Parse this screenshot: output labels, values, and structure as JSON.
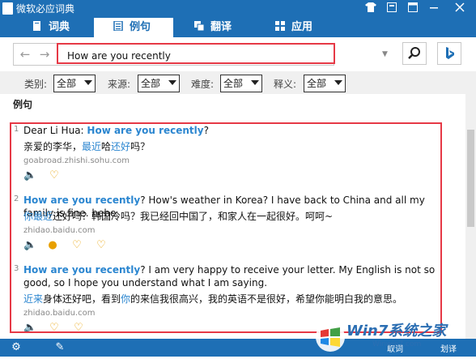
{
  "window": {
    "title": "微软必应词典",
    "controls": [
      "shirt-icon",
      "settings-icon",
      "window-icon",
      "minimize-icon",
      "close-icon"
    ]
  },
  "tabs": [
    {
      "label": "词典",
      "icon": "book-icon",
      "active": false
    },
    {
      "label": "例句",
      "icon": "list-icon",
      "active": true
    },
    {
      "label": "翻译",
      "icon": "translate-icon",
      "active": false
    },
    {
      "label": "应用",
      "icon": "apps-icon",
      "active": false
    }
  ],
  "search": {
    "value": "How are you recently",
    "placeholder": ""
  },
  "filters": [
    {
      "label": "类别:",
      "value": "全部"
    },
    {
      "label": "来源:",
      "value": "全部"
    },
    {
      "label": "难度:",
      "value": "全部"
    },
    {
      "label": "释义:",
      "value": "全部"
    }
  ],
  "section_title": "例句",
  "results": [
    {
      "num": "1",
      "en_prefix": "Dear Li Hua: ",
      "en_hl": "How are you recently",
      "en_suffix": "?",
      "zh_before": "亲爱的李华，",
      "zh_hl1": "最近",
      "zh_mid": "哈",
      "zh_hl2": "还好",
      "zh_after": "吗？",
      "source": "goabroad.zhishi.sohu.com"
    },
    {
      "num": "2",
      "en_prefix": "",
      "en_hl": "How are you recently",
      "en_suffix": "? How's weather in Korea? I have back to China and all my family is fine. hehe",
      "zh_before": "",
      "zh_hl1": "你最近",
      "zh_mid": "还好吗？韩国冷吗？我已经回中国了，和家人在一起很好。呵呵~",
      "zh_hl2": "",
      "zh_after": "",
      "source": "zhidao.baidu.com"
    },
    {
      "num": "3",
      "en_prefix": "",
      "en_hl": "How are you recently",
      "en_suffix": "? I am very happy to receive your letter. My English is not so good, so I hope you understand what I am saying.",
      "zh_before": "",
      "zh_hl1": "近来",
      "zh_mid": "身体还好吧，看到",
      "zh_hl2": "你",
      "zh_after": "的来信我很高兴，我的英语不是很好，希望你能明白我的意思。",
      "source": "zhidao.baidu.com"
    }
  ],
  "bottombar": {
    "items": [
      "取词",
      "划译"
    ]
  },
  "watermark": {
    "text": "Win7系统之家",
    "url_fragment": "Winwin7.com"
  }
}
